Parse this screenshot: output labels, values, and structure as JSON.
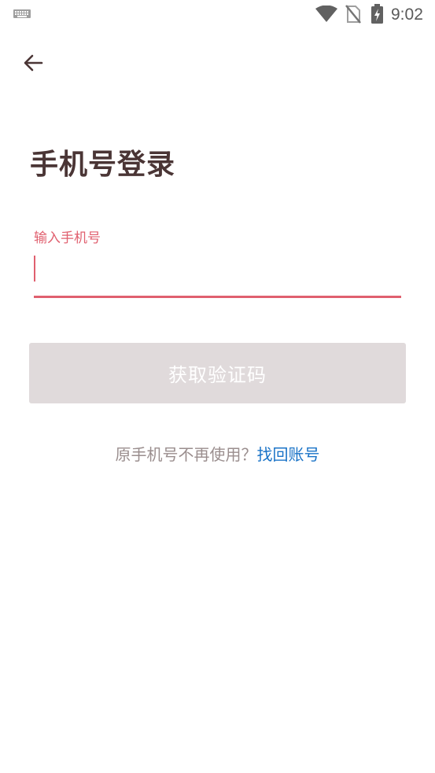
{
  "status_bar": {
    "time": "9:02",
    "icons": [
      "keyboard-icon",
      "wifi-icon",
      "no-sim-icon",
      "battery-charging-icon"
    ]
  },
  "nav": {
    "back_icon": "arrow-left-icon"
  },
  "title": "手机号登录",
  "phone_field": {
    "label": "输入手机号",
    "value": ""
  },
  "code_button": {
    "label": "获取验证码",
    "enabled": false
  },
  "recovery": {
    "text": "原手机号不再使用？",
    "link": "找回账号"
  },
  "colors": {
    "accent": "#e0606f",
    "title": "#4a3535",
    "button_disabled": "#e0dadb",
    "link": "#1a73c7",
    "muted_text": "#9a8e8e"
  }
}
